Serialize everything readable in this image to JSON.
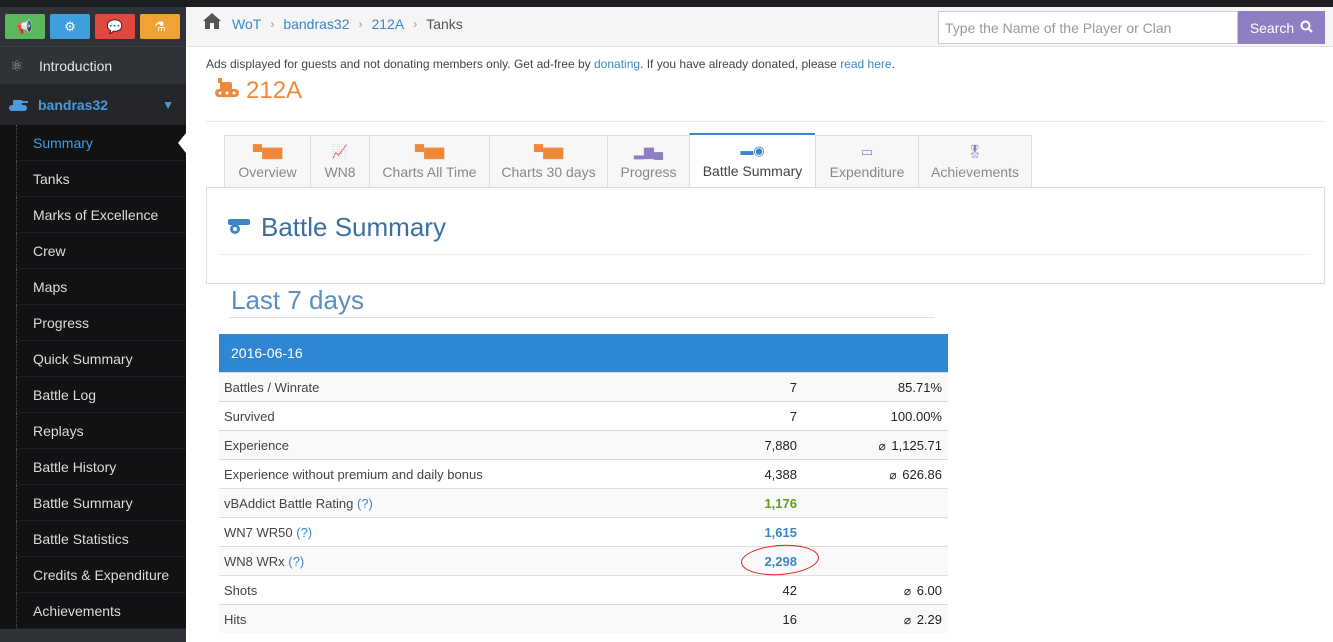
{
  "sidebar": {
    "quick_buttons": [
      {
        "icon": "megaphone-icon",
        "color": "#5cb85c"
      },
      {
        "icon": "gear-icon",
        "color": "#3ea1de"
      },
      {
        "icon": "chat-icon",
        "color": "#e0473d"
      },
      {
        "icon": "flask-icon",
        "color": "#f0a234"
      }
    ],
    "intro_label": "Introduction",
    "player_label": "bandras32",
    "items": [
      {
        "label": "Summary",
        "active": true
      },
      {
        "label": "Tanks"
      },
      {
        "label": "Marks of Excellence"
      },
      {
        "label": "Crew"
      },
      {
        "label": "Maps"
      },
      {
        "label": "Progress"
      },
      {
        "label": "Quick Summary"
      },
      {
        "label": "Battle Log"
      },
      {
        "label": "Replays"
      },
      {
        "label": "Battle History"
      },
      {
        "label": "Battle Summary"
      },
      {
        "label": "Battle Statistics"
      },
      {
        "label": "Credits & Expenditure"
      },
      {
        "label": "Achievements"
      }
    ]
  },
  "header": {
    "breadcrumb": [
      "WoT",
      "bandras32",
      "212A",
      "Tanks"
    ],
    "search_placeholder": "Type the Name of the Player or Clan",
    "search_button": "Search"
  },
  "ads": {
    "text_before": "Ads displayed for guests and not donating members only. Get ad-free by ",
    "link1": "donating",
    "text_middle": ". If you have already donated, please ",
    "link2": "read here",
    "text_after": "."
  },
  "tank_title": "212A",
  "tabs": [
    {
      "label": "Overview",
      "icon": "tank-icon"
    },
    {
      "label": "WN8",
      "icon": "line-chart-icon"
    },
    {
      "label": "Charts All Time",
      "icon": "tank-icon"
    },
    {
      "label": "Charts 30 days",
      "icon": "tank-icon"
    },
    {
      "label": "Progress",
      "icon": "bar-chart-icon"
    },
    {
      "label": "Battle Summary",
      "icon": "cannon-icon",
      "active": true
    },
    {
      "label": "Expenditure",
      "icon": "money-icon"
    },
    {
      "label": "Achievements",
      "icon": "medal-icon"
    }
  ],
  "panel_title": "Battle Summary",
  "period_title": "Last 7 days",
  "summary": {
    "date": "2016-06-16",
    "rows": [
      {
        "label": "Battles / Winrate",
        "v1": "7",
        "v2": "85.71%"
      },
      {
        "label": "Survived",
        "v1": "7",
        "v2": "100.00%"
      },
      {
        "label": "Experience",
        "v1": "7,880",
        "v2": "1,125.71",
        "avg": true
      },
      {
        "label": "Experience without premium and daily bonus",
        "v1": "4,388",
        "v2": "626.86",
        "avg": true
      },
      {
        "label": "vBAddict Battle Rating",
        "help": "(?)",
        "v1": "1,176",
        "style": "green"
      },
      {
        "label": "WN7 WR50",
        "help": "(?)",
        "v1": "1,615",
        "style": "blue"
      },
      {
        "label": "WN8 WRx",
        "help": "(?)",
        "v1": "2,298",
        "style": "blue",
        "circled": true
      },
      {
        "label": "Shots",
        "v1": "42",
        "v2": "6.00",
        "avg": true
      },
      {
        "label": "Hits",
        "v1": "16",
        "v2": "2.29",
        "avg": true
      }
    ]
  },
  "avg_symbol": "⌀"
}
